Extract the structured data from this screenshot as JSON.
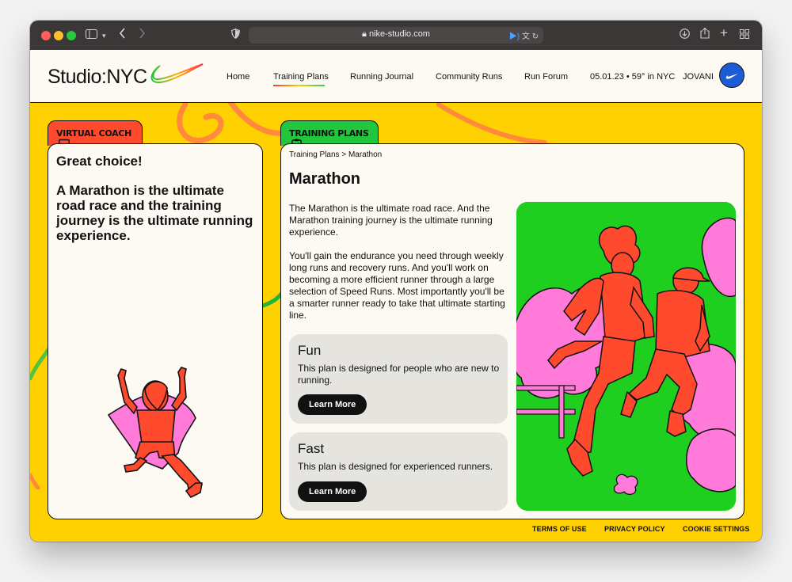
{
  "browser": {
    "url": "nike-studio.com",
    "icons": [
      "sidebar-icon",
      "chevron-down-icon",
      "back-icon",
      "forward-icon",
      "shield-icon",
      "lock-icon",
      "audio-icon",
      "translate-icon",
      "reload-icon",
      "download-icon",
      "share-icon",
      "new-tab-icon",
      "tab-overview-icon"
    ]
  },
  "header": {
    "logo": "Studio:NYC",
    "nav": [
      "Home",
      "Training Plans",
      "Running Journal",
      "Community Runs",
      "Run Forum"
    ],
    "active_nav": "Training Plans",
    "weather": "05.01.23 • 59° in NYC",
    "user": "JOVANI"
  },
  "coach": {
    "tab_label": "VIRTUAL COACH",
    "title": "Great choice!",
    "body": "A Marathon is the ultimate road race and the training journey is the ultimate running experience."
  },
  "plans": {
    "tab_label": "TRAINING PLANS",
    "breadcrumb": "Training Plans > Marathon",
    "title": "Marathon",
    "desc1": "The Marathon is the ultimate road race. And the Marathon training journey is the ultimate running experience.",
    "desc2": "You'll gain the endurance you need through weekly long runs and recovery runs. And you'll work on becoming a more efficient runner through a large selection of Speed Runs. Most importantly you'll be a smarter runner ready to take that ultimate starting line.",
    "cards": [
      {
        "title": "Fun",
        "text": "This plan is designed for people who are new to running.",
        "button": "Learn More"
      },
      {
        "title": "Fast",
        "text": "This plan is designed for experienced runners.",
        "button": "Learn More"
      }
    ]
  },
  "footer": [
    "TERMS OF USE",
    "PRIVACY POLICY",
    "COOKIE SETTINGS"
  ],
  "colors": {
    "background": "#ffd100",
    "coach_tab": "#ff4a2e",
    "plans_tab": "#20c63c",
    "illustration_bg": "#1fcf1f",
    "runner": "#ff4a2e",
    "accent_pink": "#ff7ad9"
  }
}
